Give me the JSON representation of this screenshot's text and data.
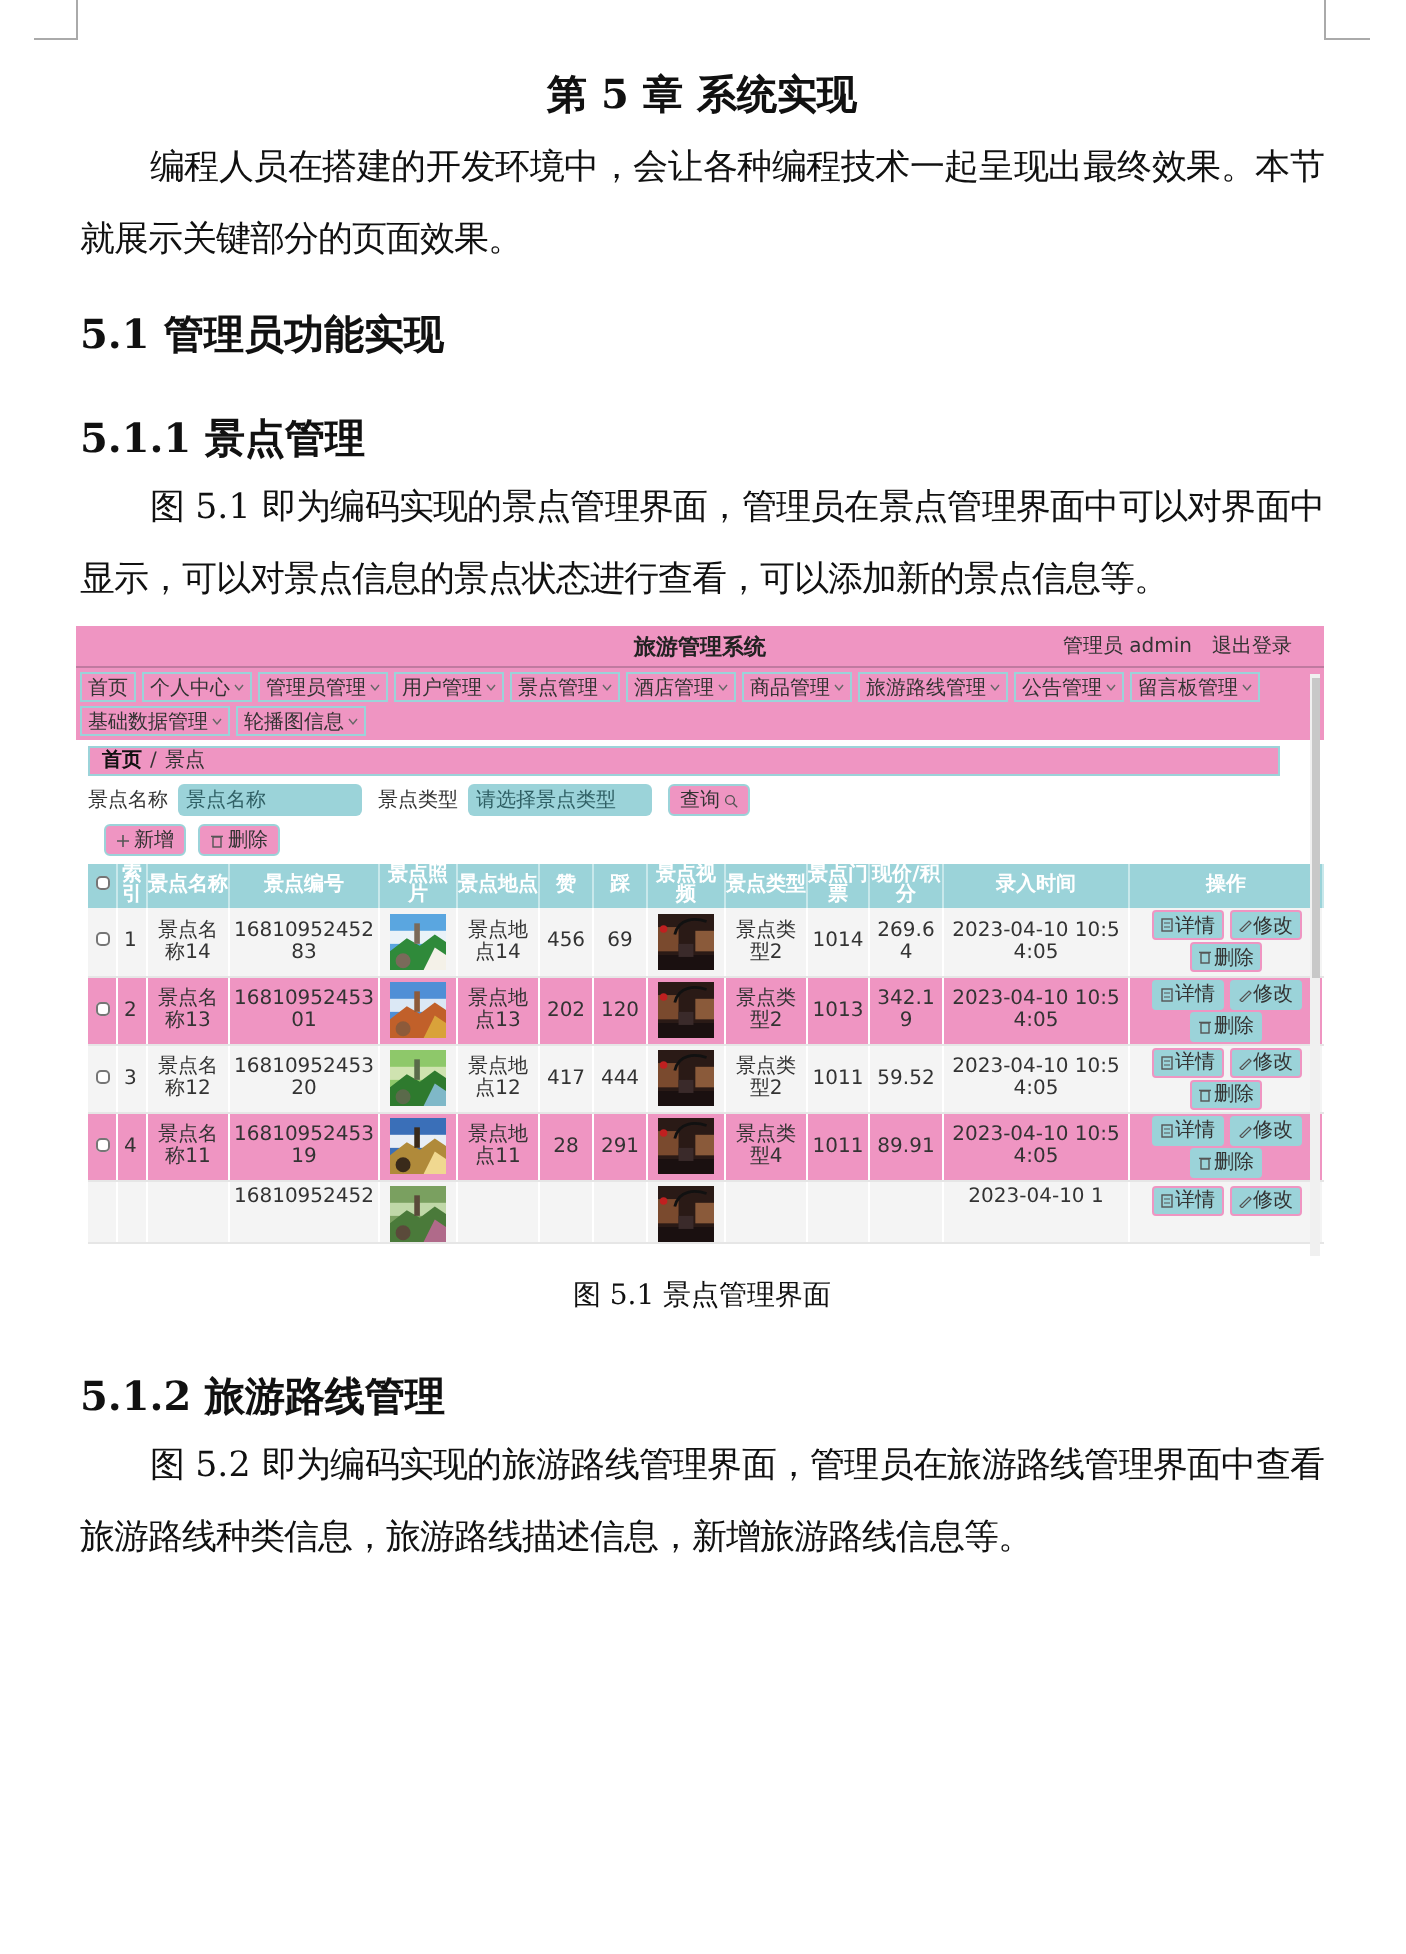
{
  "chapter_title": "第 5 章  系统实现",
  "intro": "编程人员在搭建的开发环境中，会让各种编程技术一起呈现出最终效果。本节就展示关键部分的页面效果。",
  "section": "5.1  管理员功能实现",
  "subsections": [
    {
      "heading": "5.1.1  景点管理",
      "text": "图 5.1  即为编码实现的景点管理界面，管理员在景点管理界面中可以对界面中显示，可以对景点信息的景点状态进行查看，可以添加新的景点信息等。",
      "figure": {
        "app_title": "旅游管理系统",
        "user": "管理员 admin",
        "logout": "退出登录",
        "nav": [
          {
            "label": "首页",
            "dropdown": false
          },
          {
            "label": "个人中心",
            "dropdown": true
          },
          {
            "label": "管理员管理",
            "dropdown": true
          },
          {
            "label": "用户管理",
            "dropdown": true
          },
          {
            "label": "景点管理",
            "dropdown": true
          },
          {
            "label": "酒店管理",
            "dropdown": true
          },
          {
            "label": "商品管理",
            "dropdown": true
          },
          {
            "label": "旅游路线管理",
            "dropdown": true
          },
          {
            "label": "公告管理",
            "dropdown": true
          },
          {
            "label": "留言板管理",
            "dropdown": true
          },
          {
            "label": "基础数据管理",
            "dropdown": true
          },
          {
            "label": "轮播图信息",
            "dropdown": true
          }
        ],
        "breadcrumb": [
          "首页",
          "景点"
        ],
        "breadcrumb_separator": "/",
        "filters": [
          {
            "label": "景点名称",
            "placeholder": "景点名称"
          },
          {
            "label": "景点类型",
            "placeholder": "请选择景点类型"
          }
        ],
        "search_button": "查询",
        "actions": [
          {
            "label": "新增",
            "kind": "add"
          },
          {
            "label": "删除",
            "kind": "delete"
          }
        ],
        "all_checked": false,
        "columns": [
          "索引",
          "景点名称",
          "景点编号",
          "景点照片",
          "景点地点",
          "赞",
          "踩",
          "景点视频",
          "景点类型",
          "景点门票",
          "现价/积分",
          "录入时间",
          "操作"
        ],
        "rows": [
          {
            "checked": false,
            "cells": [
              "1",
              "景点名称14",
              "1681095245283",
              "",
              "景点地点14",
              "456",
              "69",
              "",
              "景点类型2",
              "1014",
              "269.64",
              "2023-04-10 10:54:05"
            ],
            "buttons": [
              {
                "label": "详情",
                "kind": "detail"
              },
              {
                "label": "修改",
                "kind": "edit"
              },
              {
                "label": "删除",
                "kind": "delete"
              }
            ]
          },
          {
            "checked": false,
            "cells": [
              "2",
              "景点名称13",
              "1681095245301",
              "",
              "景点地点13",
              "202",
              "120",
              "",
              "景点类型2",
              "1013",
              "342.19",
              "2023-04-10 10:54:05"
            ],
            "buttons": [
              {
                "label": "详情",
                "kind": "detail"
              },
              {
                "label": "修改",
                "kind": "edit"
              },
              {
                "label": "删除",
                "kind": "delete"
              }
            ]
          },
          {
            "checked": false,
            "cells": [
              "3",
              "景点名称12",
              "1681095245320",
              "",
              "景点地点12",
              "417",
              "444",
              "",
              "景点类型2",
              "1011",
              "59.52",
              "2023-04-10 10:54:05"
            ],
            "buttons": [
              {
                "label": "详情",
                "kind": "detail"
              },
              {
                "label": "修改",
                "kind": "edit"
              },
              {
                "label": "删除",
                "kind": "delete"
              }
            ]
          },
          {
            "checked": false,
            "cells": [
              "4",
              "景点名称11",
              "1681095245319",
              "",
              "景点地点11",
              "28",
              "291",
              "",
              "景点类型4",
              "1011",
              "89.91",
              "2023-04-10 10:54:05"
            ],
            "buttons": [
              {
                "label": "详情",
                "kind": "detail"
              },
              {
                "label": "修改",
                "kind": "edit"
              },
              {
                "label": "删除",
                "kind": "delete"
              }
            ]
          },
          {
            "cells": [
              "",
              "",
              "16810952452",
              "",
              "",
              "",
              "",
              "",
              "",
              "",
              "",
              "2023-04-10 1"
            ],
            "buttons": [
              {
                "label": "详情",
                "kind": "detail"
              },
              {
                "label": "修改",
                "kind": "edit"
              }
            ]
          }
        ]
      },
      "caption": "图 5.1  景点管理界面"
    },
    {
      "heading": "5.1.2  旅游路线管理",
      "text": "图 5.2  即为编码实现的旅游路线管理界面，管理员在旅游路线管理界面中查看旅游路线种类信息，旅游路线描述信息，新增旅游路线信息等。"
    }
  ]
}
